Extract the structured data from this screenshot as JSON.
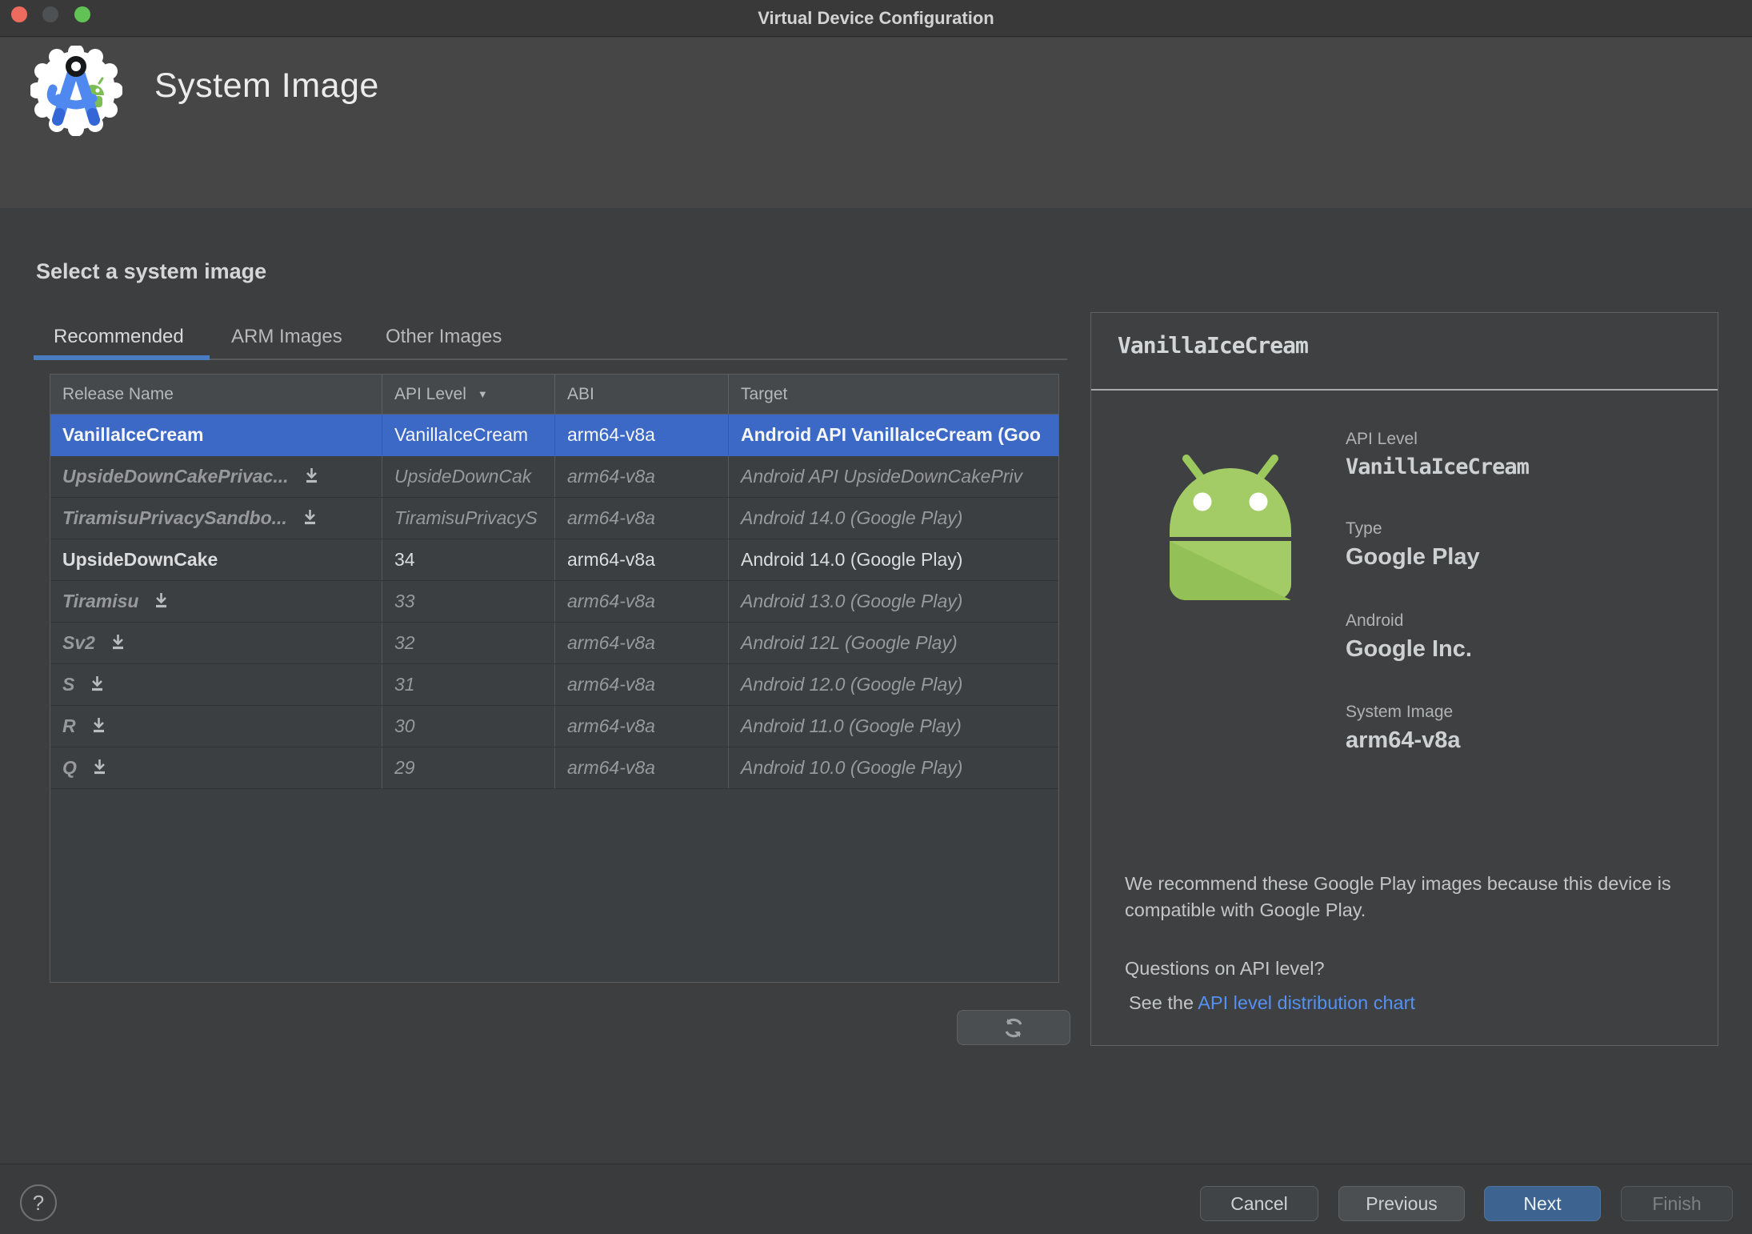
{
  "window": {
    "title": "Virtual Device Configuration"
  },
  "header": {
    "title": "System Image"
  },
  "content": {
    "heading": "Select a system image",
    "tabs": [
      {
        "label": "Recommended",
        "active": true
      },
      {
        "label": "ARM Images",
        "active": false
      },
      {
        "label": "Other Images",
        "active": false
      }
    ]
  },
  "table": {
    "columns": [
      "Release Name",
      "API Level",
      "ABI",
      "Target"
    ],
    "sort_column": "API Level",
    "sort_icon": "▼",
    "rows": [
      {
        "release": "VanillaIceCream",
        "api": "VanillaIceCream",
        "abi": "arm64-v8a",
        "target": "Android API VanillaIceCream (Goo",
        "state": "selected",
        "download": false
      },
      {
        "release": "UpsideDownCakePrivac...",
        "api": "UpsideDownCak",
        "abi": "arm64-v8a",
        "target": "Android API UpsideDownCakePriv",
        "state": "remote",
        "download": true
      },
      {
        "release": "TiramisuPrivacySandbo...",
        "api": "TiramisuPrivacyS",
        "abi": "arm64-v8a",
        "target": "Android 14.0 (Google Play)",
        "state": "remote",
        "download": true
      },
      {
        "release": "UpsideDownCake",
        "api": "34",
        "abi": "arm64-v8a",
        "target": "Android 14.0 (Google Play)",
        "state": "installed",
        "download": false
      },
      {
        "release": "Tiramisu",
        "api": "33",
        "abi": "arm64-v8a",
        "target": "Android 13.0 (Google Play)",
        "state": "remote",
        "download": true
      },
      {
        "release": "Sv2",
        "api": "32",
        "abi": "arm64-v8a",
        "target": "Android 12L (Google Play)",
        "state": "remote",
        "download": true
      },
      {
        "release": "S",
        "api": "31",
        "abi": "arm64-v8a",
        "target": "Android 12.0 (Google Play)",
        "state": "remote",
        "download": true
      },
      {
        "release": "R",
        "api": "30",
        "abi": "arm64-v8a",
        "target": "Android 11.0 (Google Play)",
        "state": "remote",
        "download": true
      },
      {
        "release": "Q",
        "api": "29",
        "abi": "arm64-v8a",
        "target": "Android 10.0 (Google Play)",
        "state": "remote",
        "download": true
      }
    ]
  },
  "details": {
    "title": "VanillaIceCream",
    "api_level_label": "API Level",
    "api_level_value": "VanillaIceCream",
    "type_label": "Type",
    "type_value": "Google Play",
    "vendor_label": "Android",
    "vendor_value": "Google Inc.",
    "system_image_label": "System Image",
    "system_image_value": "arm64-v8a",
    "note_line": "We recommend these Google Play images because this device is compatible with Google Play.",
    "question": "Questions on API level?",
    "see_the": "See the ",
    "link_text": "API level distribution chart"
  },
  "footer": {
    "help": "?",
    "cancel": "Cancel",
    "previous": "Previous",
    "next": "Next",
    "finish": "Finish"
  },
  "colors": {
    "selection_blue": "#3d69c6",
    "tab_underline_blue": "#4a7cc2",
    "next_button_blue": "#3d6391",
    "link_blue": "#5591f2",
    "android_green": "#a2cb66",
    "logo_blue": "#4f89ef",
    "traffic_red": "#ed6a5e",
    "traffic_green": "#61c355"
  }
}
